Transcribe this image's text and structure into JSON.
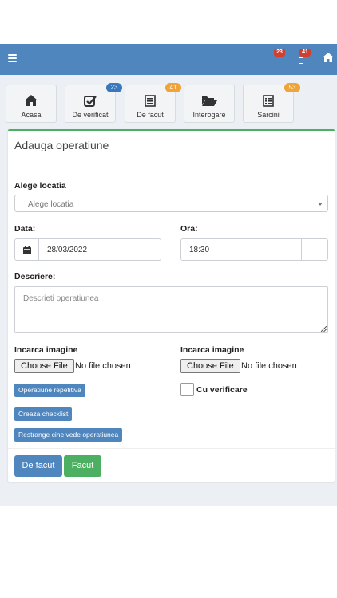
{
  "header": {
    "badge_notifications": "23",
    "badge_tasks": "41"
  },
  "tiles": [
    {
      "label": "Acasa",
      "badge": "",
      "icon": "home-icon"
    },
    {
      "label": "De verificat",
      "badge": "23",
      "icon": "checkbox-icon"
    },
    {
      "label": "De facut",
      "badge": "41",
      "icon": "list-icon"
    },
    {
      "label": "Interogare",
      "badge": "",
      "icon": "folder-open-icon"
    },
    {
      "label": "Sarcini",
      "badge": "53",
      "icon": "list-icon"
    }
  ],
  "colors": {
    "navbar": "#4f86be",
    "primary": "#4f86be",
    "success": "#4caf62",
    "badge_blue": "#3a78bd",
    "badge_orange": "#f0a336",
    "badge_red": "#d23f2e"
  },
  "form": {
    "title": "Adauga operatiune",
    "location_label": "Alege locatia",
    "location_placeholder": "Alege locatia",
    "date_label": "Data:",
    "date_value": "28/03/2022",
    "time_label": "Ora:",
    "time_value": "18:30",
    "description_label": "Descriere:",
    "description_placeholder": "Descrieti operatiunea",
    "upload_label_1": "Incarca imagine",
    "upload_label_2": "Incarca imagine",
    "choose_file": "Choose File",
    "no_file": "No file chosen",
    "repetitive_button": "Operatiune repetitiva",
    "checklist_button": "Creaza checklist",
    "restrict_button": "Restrange cine vede operatiunea",
    "verify_label": "Cu verificare",
    "todo_button": "De facut",
    "done_button": "Facut"
  }
}
